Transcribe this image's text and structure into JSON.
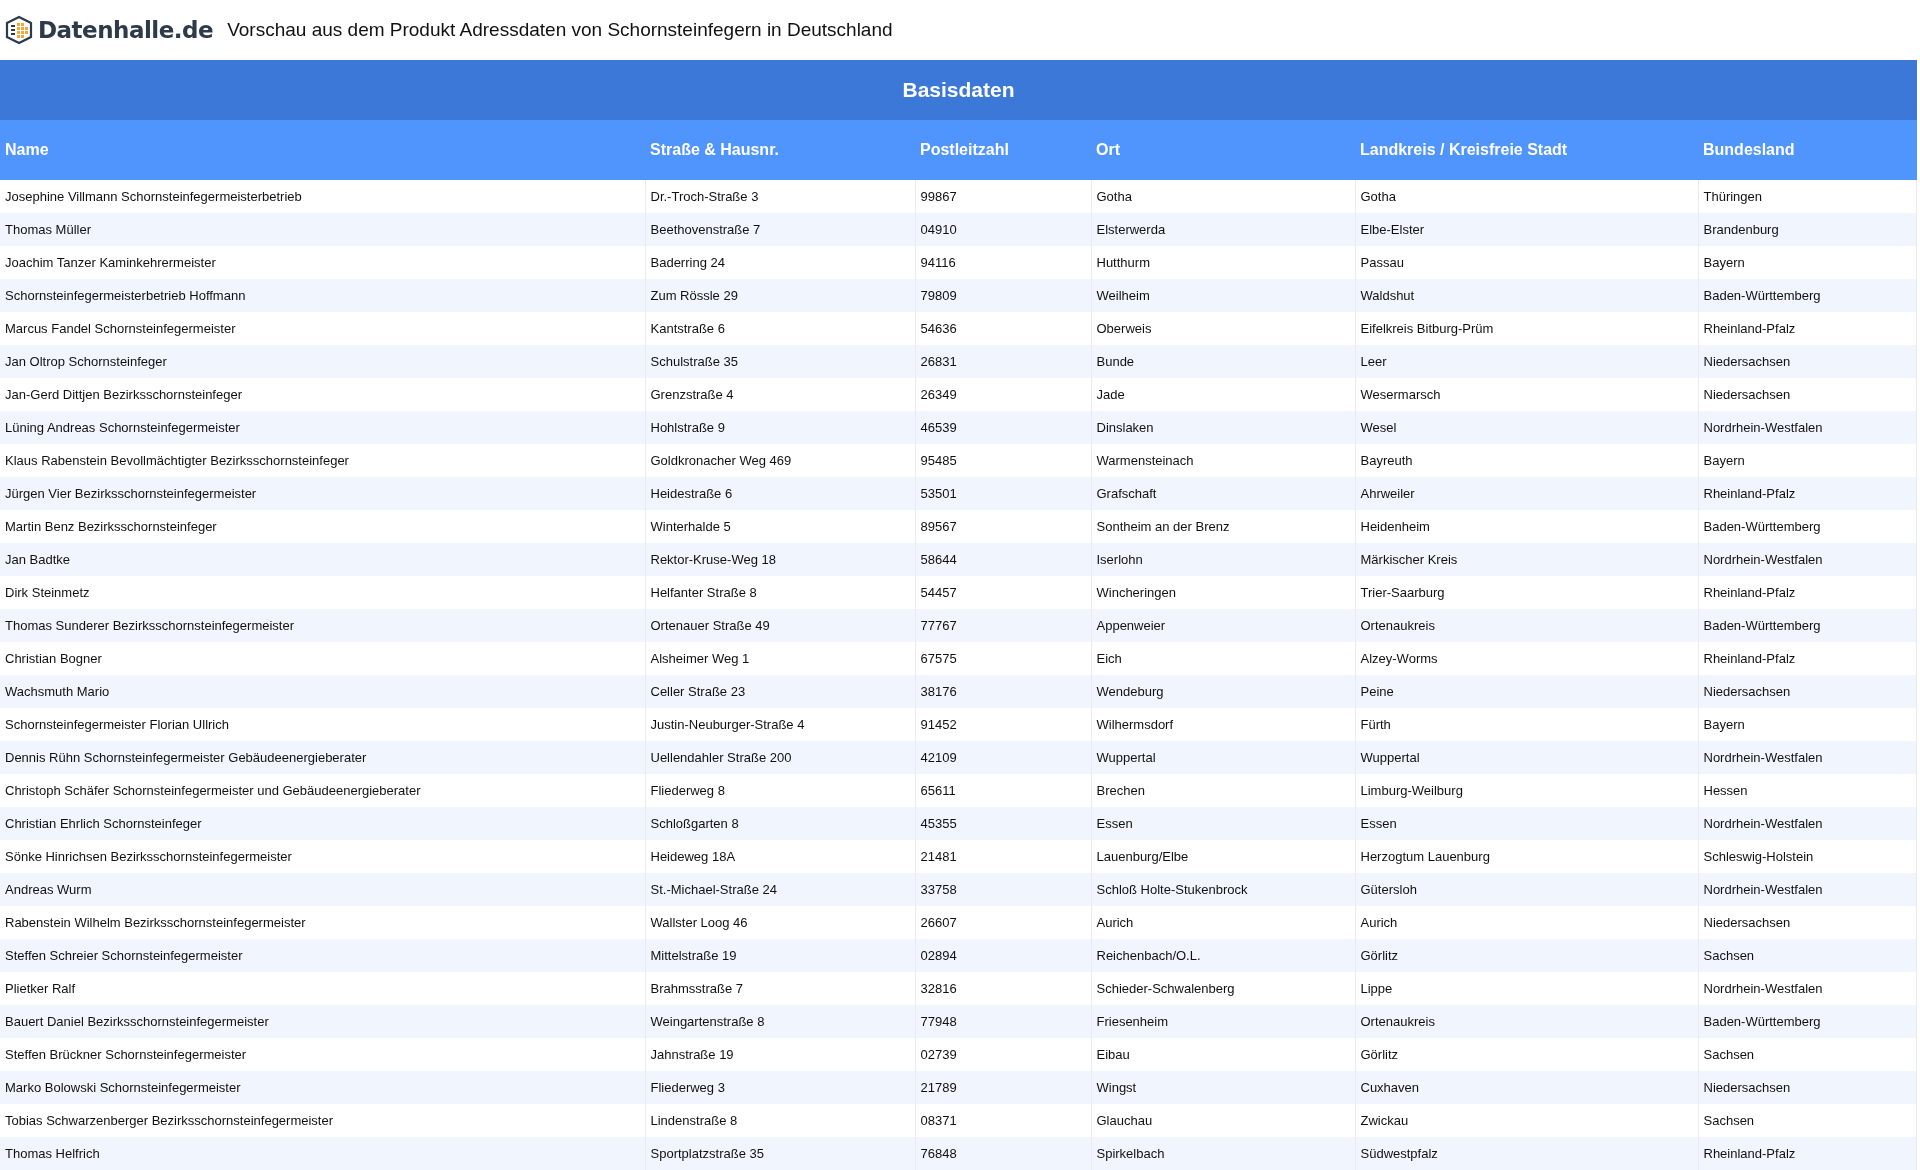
{
  "header": {
    "logo": "Datenhalle.de",
    "title": "Vorschau aus dem Produkt Adressdaten von Schornsteinfegern in Deutschland"
  },
  "table": {
    "caption": "Basisdaten",
    "columns": [
      "Name",
      "Straße & Hausnr.",
      "Postleitzahl",
      "Ort",
      "Landkreis / Kreisfreie Stadt",
      "Bundesland"
    ],
    "rows": [
      [
        "Josephine Villmann Schornsteinfegermeisterbetrieb",
        "Dr.-Troch-Straße 3",
        "99867",
        "Gotha",
        "Gotha",
        "Thüringen"
      ],
      [
        "Thomas Müller",
        "Beethovenstraße 7",
        "04910",
        "Elsterwerda",
        "Elbe-Elster",
        "Brandenburg"
      ],
      [
        "Joachim Tanzer Kaminkehrermeister",
        "Baderring 24",
        "94116",
        "Hutthurm",
        "Passau",
        "Bayern"
      ],
      [
        "Schornsteinfegermeisterbetrieb Hoffmann",
        "Zum Rössle 29",
        "79809",
        "Weilheim",
        "Waldshut",
        "Baden-Württemberg"
      ],
      [
        "Marcus Fandel Schornsteinfegermeister",
        "Kantstraße 6",
        "54636",
        "Oberweis",
        "Eifelkreis Bitburg-Prüm",
        "Rheinland-Pfalz"
      ],
      [
        "Jan Oltrop Schornsteinfeger",
        "Schulstraße 35",
        "26831",
        "Bunde",
        "Leer",
        "Niedersachsen"
      ],
      [
        "Jan-Gerd Dittjen Bezirksschornsteinfeger",
        "Grenzstraße 4",
        "26349",
        "Jade",
        "Wesermarsch",
        "Niedersachsen"
      ],
      [
        "Lüning Andreas Schornsteinfegermeister",
        "Hohlstraße 9",
        "46539",
        "Dinslaken",
        "Wesel",
        "Nordrhein-Westfalen"
      ],
      [
        "Klaus Rabenstein Bevollmächtigter Bezirksschornsteinfeger",
        "Goldkronacher Weg 469",
        "95485",
        "Warmensteinach",
        "Bayreuth",
        "Bayern"
      ],
      [
        "Jürgen Vier Bezirksschornsteinfegermeister",
        "Heidestraße 6",
        "53501",
        "Grafschaft",
        "Ahrweiler",
        "Rheinland-Pfalz"
      ],
      [
        "Martin Benz Bezirksschornsteinfeger",
        "Winterhalde 5",
        "89567",
        "Sontheim an der Brenz",
        "Heidenheim",
        "Baden-Württemberg"
      ],
      [
        "Jan Badtke",
        "Rektor-Kruse-Weg 18",
        "58644",
        "Iserlohn",
        "Märkischer Kreis",
        "Nordrhein-Westfalen"
      ],
      [
        "Dirk Steinmetz",
        "Helfanter Straße 8",
        "54457",
        "Wincheringen",
        "Trier-Saarburg",
        "Rheinland-Pfalz"
      ],
      [
        "Thomas Sunderer Bezirksschornsteinfegermeister",
        "Ortenauer Straße 49",
        "77767",
        "Appenweier",
        "Ortenaukreis",
        "Baden-Württemberg"
      ],
      [
        "Christian Bogner",
        "Alsheimer Weg 1",
        "67575",
        "Eich",
        "Alzey-Worms",
        "Rheinland-Pfalz"
      ],
      [
        "Wachsmuth Mario",
        "Celler Straße 23",
        "38176",
        "Wendeburg",
        "Peine",
        "Niedersachsen"
      ],
      [
        "Schornsteinfegermeister Florian Ullrich",
        "Justin-Neuburger-Straße 4",
        "91452",
        "Wilhermsdorf",
        "Fürth",
        "Bayern"
      ],
      [
        "Dennis Rühn Schornsteinfegermeister Gebäudeenergieberater",
        "Uellendahler Straße 200",
        "42109",
        "Wuppertal",
        "Wuppertal",
        "Nordrhein-Westfalen"
      ],
      [
        "Christoph Schäfer Schornsteinfegermeister und Gebäudeenergieberater",
        "Fliederweg 8",
        "65611",
        "Brechen",
        "Limburg-Weilburg",
        "Hessen"
      ],
      [
        "Christian Ehrlich Schornsteinfeger",
        "Schloßgarten 8",
        "45355",
        "Essen",
        "Essen",
        "Nordrhein-Westfalen"
      ],
      [
        "Sönke Hinrichsen Bezirksschornsteinfegermeister",
        "Heideweg 18A",
        "21481",
        "Lauenburg/Elbe",
        "Herzogtum Lauenburg",
        "Schleswig-Holstein"
      ],
      [
        "Andreas Wurm",
        "St.-Michael-Straße 24",
        "33758",
        "Schloß Holte-Stukenbrock",
        "Gütersloh",
        "Nordrhein-Westfalen"
      ],
      [
        "Rabenstein Wilhelm Bezirksschornsteinfegermeister",
        "Wallster Loog 46",
        "26607",
        "Aurich",
        "Aurich",
        "Niedersachsen"
      ],
      [
        "Steffen Schreier Schornsteinfegermeister",
        "Mittelstraße 19",
        "02894",
        "Reichenbach/O.L.",
        "Görlitz",
        "Sachsen"
      ],
      [
        "Plietker Ralf",
        "Brahmsstraße 7",
        "32816",
        "Schieder-Schwalenberg",
        "Lippe",
        "Nordrhein-Westfalen"
      ],
      [
        "Bauert Daniel Bezirksschornsteinfegermeister",
        "Weingartenstraße 8",
        "77948",
        "Friesenheim",
        "Ortenaukreis",
        "Baden-Württemberg"
      ],
      [
        "Steffen Brückner Schornsteinfegermeister",
        "Jahnstraße 19",
        "02739",
        "Eibau",
        "Görlitz",
        "Sachsen"
      ],
      [
        "Marko Bolowski Schornsteinfegermeister",
        "Fliederweg 3",
        "21789",
        "Wingst",
        "Cuxhaven",
        "Niedersachsen"
      ],
      [
        "Tobias Schwarzenberger Bezirksschornsteinfegermeister",
        "Lindenstraße 8",
        "08371",
        "Glauchau",
        "Zwickau",
        "Sachsen"
      ],
      [
        "Thomas Helfrich",
        "Sportplatzstraße 35",
        "76848",
        "Spirkelbach",
        "Südwestpfalz",
        "Rheinland-Pfalz"
      ]
    ]
  }
}
